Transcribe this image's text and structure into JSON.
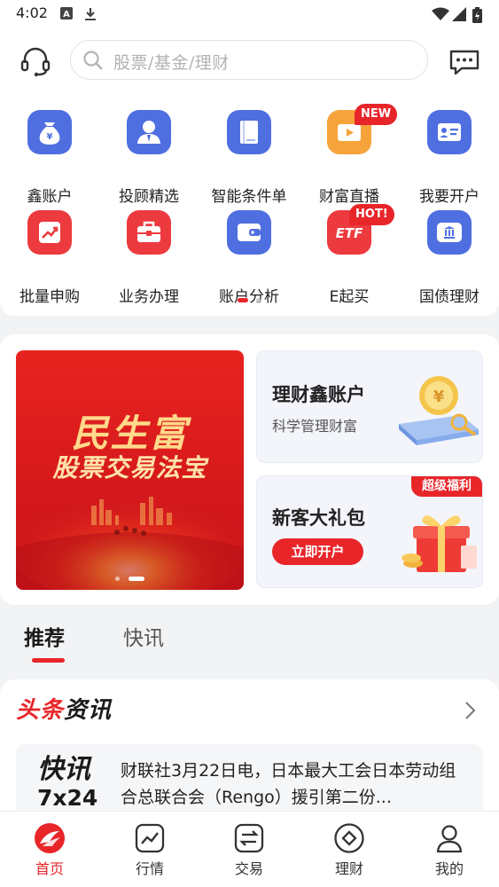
{
  "status_bar": {
    "time": "4:02"
  },
  "search": {
    "placeholder": "股票/基金/理财"
  },
  "quick_menu": [
    {
      "label": "鑫账户",
      "icon": "money-bag-icon"
    },
    {
      "label": "投顾精选",
      "icon": "advisor-icon"
    },
    {
      "label": "智能条件单",
      "icon": "book-icon"
    },
    {
      "label": "财富直播",
      "icon": "video-icon",
      "badge": "NEW"
    },
    {
      "label": "我要开户",
      "icon": "id-card-icon"
    },
    {
      "label": "批量申购",
      "icon": "trend-chart-icon"
    },
    {
      "label": "业务办理",
      "icon": "briefcase-icon"
    },
    {
      "label": "账户分析",
      "icon": "wallet-icon"
    },
    {
      "label": "E起买",
      "icon": "etf-icon",
      "badge": "HOT!",
      "icon_text": "ETF"
    },
    {
      "label": "国债理财",
      "icon": "treasury-bond-icon"
    }
  ],
  "banner": {
    "line1": "民生富",
    "line2": "股票交易法宝"
  },
  "promo_boxes": {
    "box1": {
      "title": "理财鑫账户",
      "subtitle": "科学管理财富"
    },
    "box2": {
      "title": "新客大礼包",
      "button": "立即开户",
      "tag": "超级福利"
    }
  },
  "tabs": [
    {
      "label": "推荐",
      "active": true
    },
    {
      "label": "快讯",
      "active": false
    }
  ],
  "news": {
    "title_red": "头条",
    "title_black": "资讯",
    "logo_line1": "快讯",
    "logo_line2": "7x24",
    "item_text": "财联社3月22日电，日本最大工会日本劳动组合总联合会（Rengo）援引第二份..."
  },
  "bottom_nav": [
    {
      "label": "首页",
      "icon": "home-logo-icon",
      "active": true
    },
    {
      "label": "行情",
      "icon": "market-chart-icon",
      "active": false
    },
    {
      "label": "交易",
      "icon": "trade-exchange-icon",
      "active": false
    },
    {
      "label": "理财",
      "icon": "wealth-diamond-icon",
      "active": false
    },
    {
      "label": "我的",
      "icon": "profile-icon",
      "active": false
    }
  ],
  "colors": {
    "brand_red": "#e8262a",
    "icon_blue": "#4f6fe0",
    "icon_orange": "#f7a33b"
  }
}
